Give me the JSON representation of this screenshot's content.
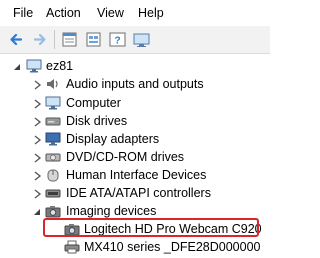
{
  "menu": {
    "file": "File",
    "action": "Action",
    "view": "View",
    "help": "Help"
  },
  "toolbar": {
    "buttons": [
      "back-icon",
      "forward-icon",
      "properties-icon",
      "scan-icon",
      "help-icon",
      "display-icon"
    ]
  },
  "tree": {
    "root": "ez81",
    "categories": [
      "Audio inputs and outputs",
      "Computer",
      "Disk drives",
      "Display adapters",
      "DVD/CD-ROM drives",
      "Human Interface Devices",
      "IDE ATA/ATAPI controllers",
      "Imaging devices"
    ],
    "imaging_children": [
      "Logitech HD Pro Webcam C920",
      "MX410 series _DFE28D000000"
    ]
  },
  "colors": {
    "highlight_border": "#d9262c",
    "toolbar_bg": "#f2f2f2"
  }
}
